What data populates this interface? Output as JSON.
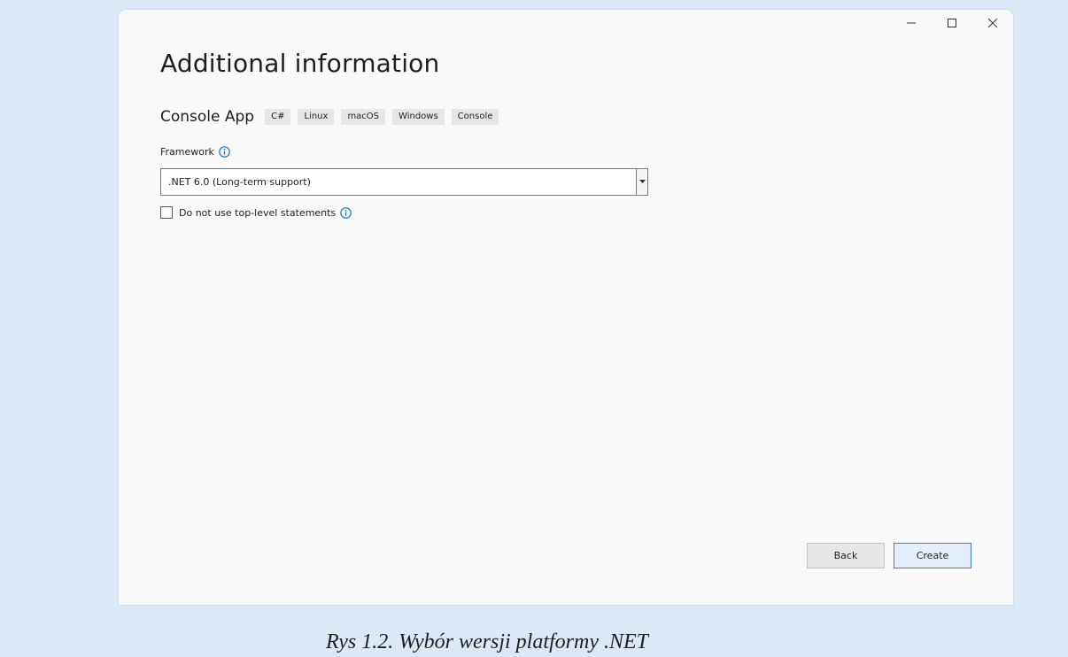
{
  "window": {
    "title": "Additional information",
    "controls": {
      "minimize_icon": "minimize-icon",
      "maximize_icon": "maximize-icon",
      "close_icon": "close-icon"
    }
  },
  "template": {
    "name": "Console App",
    "tags": [
      "C#",
      "Linux",
      "macOS",
      "Windows",
      "Console"
    ]
  },
  "framework": {
    "label": "Framework",
    "selected": ".NET 6.0 (Long-term support)",
    "info_icon": "info-icon"
  },
  "top_level_statements": {
    "label": "Do not use top-level statements",
    "checked": false
  },
  "buttons": {
    "back": "Back",
    "create": "Create"
  },
  "caption": "Rys 1.2. Wybór wersji platformy .NET",
  "colors": {
    "background": "#dce8f5",
    "accent": "#3a7bd5",
    "info": "#1a73c8"
  }
}
